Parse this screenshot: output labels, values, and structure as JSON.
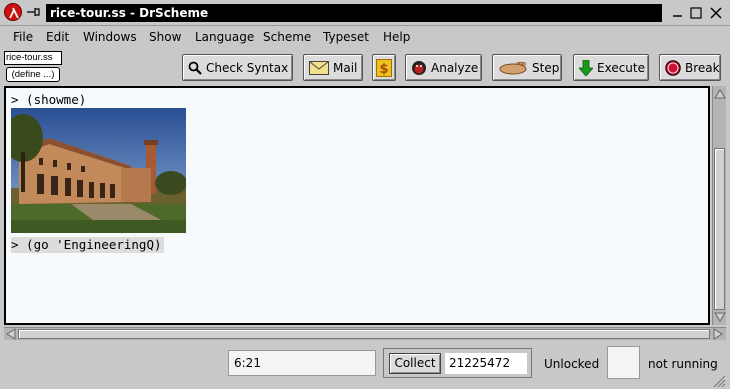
{
  "window": {
    "title": "rice-tour.ss - DrScheme"
  },
  "menubar": {
    "items": [
      "File",
      "Edit",
      "Windows",
      "Show",
      "Language",
      "Scheme",
      "Typeset",
      "Help"
    ]
  },
  "toolbar": {
    "file_name": "rice-tour.ss",
    "define_label": "(define ...)",
    "check_syntax_label": "Check Syntax",
    "mail_label": "Mail",
    "analyze_label": "Analyze",
    "step_label": "Step",
    "execute_label": "Execute",
    "break_label": "Break",
    "icons": {
      "check_syntax": "magnifier-icon",
      "mail": "envelope-icon",
      "dollar": "dollar-icon",
      "analyze": "spider-icon",
      "step": "foot-icon",
      "execute": "green-down-arrow-icon",
      "break": "stop-sign-icon"
    }
  },
  "repl": {
    "line1": "> (showme)",
    "line2": "> (go 'EngineeringQ)",
    "image_subject": "campus-building-photo"
  },
  "status": {
    "position": "6:21",
    "collect_label": "Collect",
    "memory": "21225472",
    "lock_state": "Unlocked",
    "run_state": "not running"
  },
  "colors": {
    "chrome": "#c8c8c8",
    "title_bar": "#000000",
    "pane_bg": "#f6fafd",
    "execute_arrow": "#1a9a1a",
    "break_stop": "#cc1133"
  }
}
